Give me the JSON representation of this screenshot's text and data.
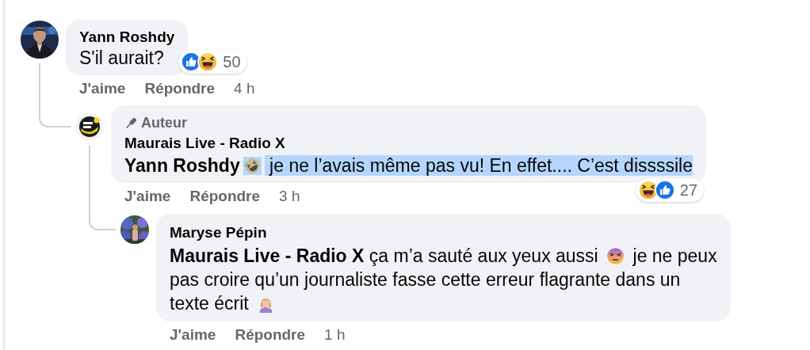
{
  "comments": [
    {
      "avatar": {
        "kind": "picture"
      },
      "author": "Yann Roshdy",
      "message": [
        {
          "kind": "text",
          "text": "S'il aurait?",
          "highlighted": false
        }
      ],
      "reactions": {
        "icons": [
          {
            "kind": "like"
          },
          {
            "kind": "haha"
          }
        ],
        "count": "50"
      },
      "actions": {
        "like": "J'aime",
        "reply": "Répondre",
        "time": "4 h"
      },
      "replies": [
        {
          "avatar": {
            "kind": "logo"
          },
          "badge": "Auteur",
          "author": "Maurais Live - Radio X",
          "message": [
            {
              "kind": "mention",
              "text": "Yann Roshdy",
              "highlighted": false
            },
            {
              "kind": "rofl",
              "highlighted": true
            },
            {
              "kind": "text",
              "text": " je ne l’avais même pas vu! En effet.... C’est dissssile",
              "highlighted": true
            }
          ],
          "reactions": {
            "icons": [
              {
                "kind": "haha"
              },
              {
                "kind": "like"
              }
            ],
            "count": "27"
          },
          "actions": {
            "like": "J'aime",
            "reply": "Répondre",
            "time": "3 h"
          },
          "replies": [
            {
              "avatar": {
                "kind": "picture"
              },
              "author": "Maryse Pépin",
              "message": [
                {
                  "kind": "mention",
                  "text": "Maurais Live - Radio X",
                  "highlighted": false
                },
                {
                  "kind": "text",
                  "text": " ça m’a sauté aux yeux aussi ",
                  "highlighted": false
                },
                {
                  "kind": "dizzy",
                  "highlighted": false
                },
                {
                  "kind": "text",
                  "text": " je ne peux",
                  "highlighted": false
                },
                {
                  "kind": "break"
                },
                {
                  "kind": "text",
                  "text": "pas croire qu’un journaliste fasse cette erreur flagrante dans un",
                  "highlighted": false
                },
                {
                  "kind": "break"
                },
                {
                  "kind": "text",
                  "text": "texte écrit ",
                  "highlighted": false
                },
                {
                  "kind": "facepalm",
                  "highlighted": false
                }
              ],
              "actions": {
                "like": "J'aime",
                "reply": "Répondre",
                "time": "1 h"
              }
            }
          ]
        }
      ]
    }
  ]
}
